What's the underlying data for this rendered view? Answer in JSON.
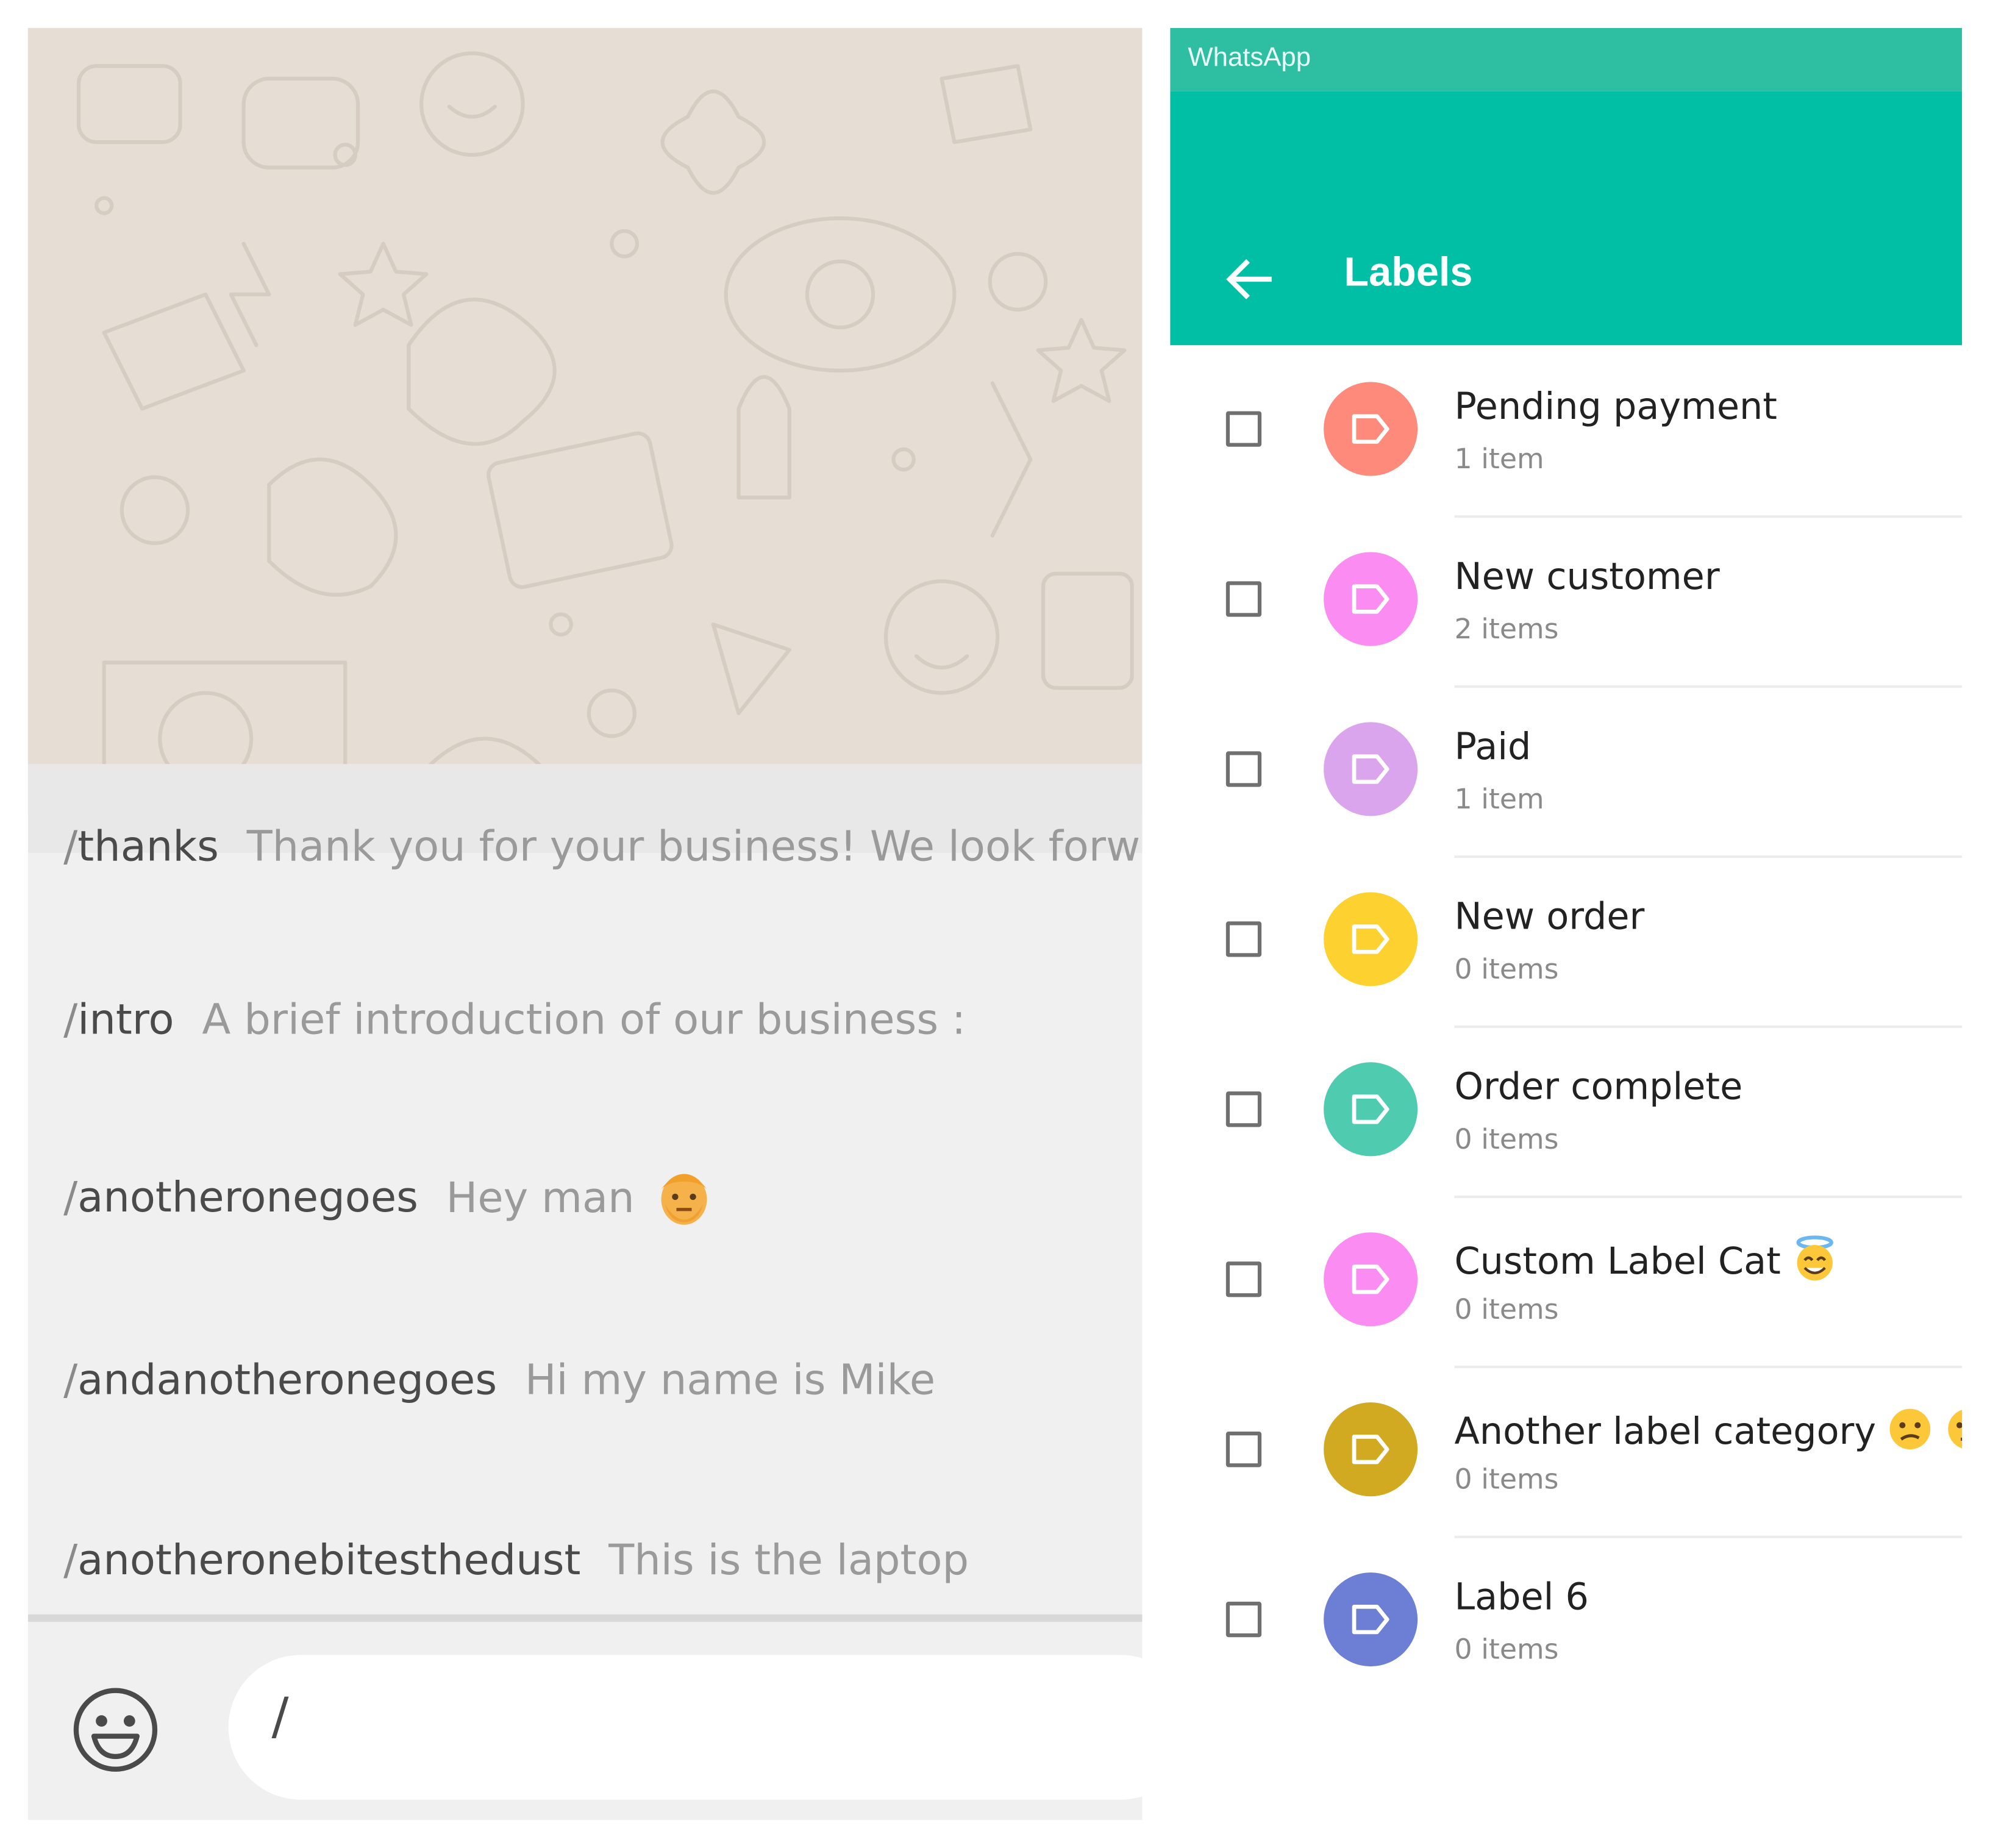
{
  "colors": {
    "chat_wallpaper": "#e6ddd4",
    "chat_panel": "#f0f0f0",
    "status_bar": "#2ebfa2",
    "app_bar": "#00bfa5"
  },
  "chat": {
    "quick_replies": [
      {
        "shortcut": "thanks",
        "message": "Thank you for your business! We look forw"
      },
      {
        "shortcut": "intro",
        "message": "A brief introduction of our business :"
      },
      {
        "shortcut": "anotheronegoes",
        "message": "Hey man",
        "emoji": "man-emoji"
      },
      {
        "shortcut": "andanotheronegoes",
        "message": "Hi my name is Mike"
      },
      {
        "shortcut": "anotheronebitesthedust",
        "message": "This is the laptop"
      }
    ],
    "slash": "/",
    "composer": {
      "value": "/",
      "emoji_icon": "smiley-icon"
    }
  },
  "labels_panel": {
    "status_app_name": "WhatsApp",
    "title": "Labels",
    "back_icon": "arrow-left-icon",
    "items": [
      {
        "name": "Pending payment",
        "count": "1 item",
        "color": "#fd8a7a"
      },
      {
        "name": "New customer",
        "count": "2 items",
        "color": "#fb8cf1"
      },
      {
        "name": "Paid",
        "count": "1 item",
        "color": "#dba5ee"
      },
      {
        "name": "New order",
        "count": "0 items",
        "color": "#fdd12f"
      },
      {
        "name": "Order complete",
        "count": "0 items",
        "color": "#4fcbb0"
      },
      {
        "name": "Custom Label Cat",
        "count": "0 items",
        "color": "#fb8cf1",
        "emojis": [
          "angel-emoji"
        ]
      },
      {
        "name": "Another label category",
        "count": "0 items",
        "color": "#d2aa22",
        "emojis": [
          "confused-emoji",
          "monocle-emoji"
        ]
      },
      {
        "name": "Label 6",
        "count": "0 items",
        "color": "#6c7fd4"
      }
    ]
  }
}
